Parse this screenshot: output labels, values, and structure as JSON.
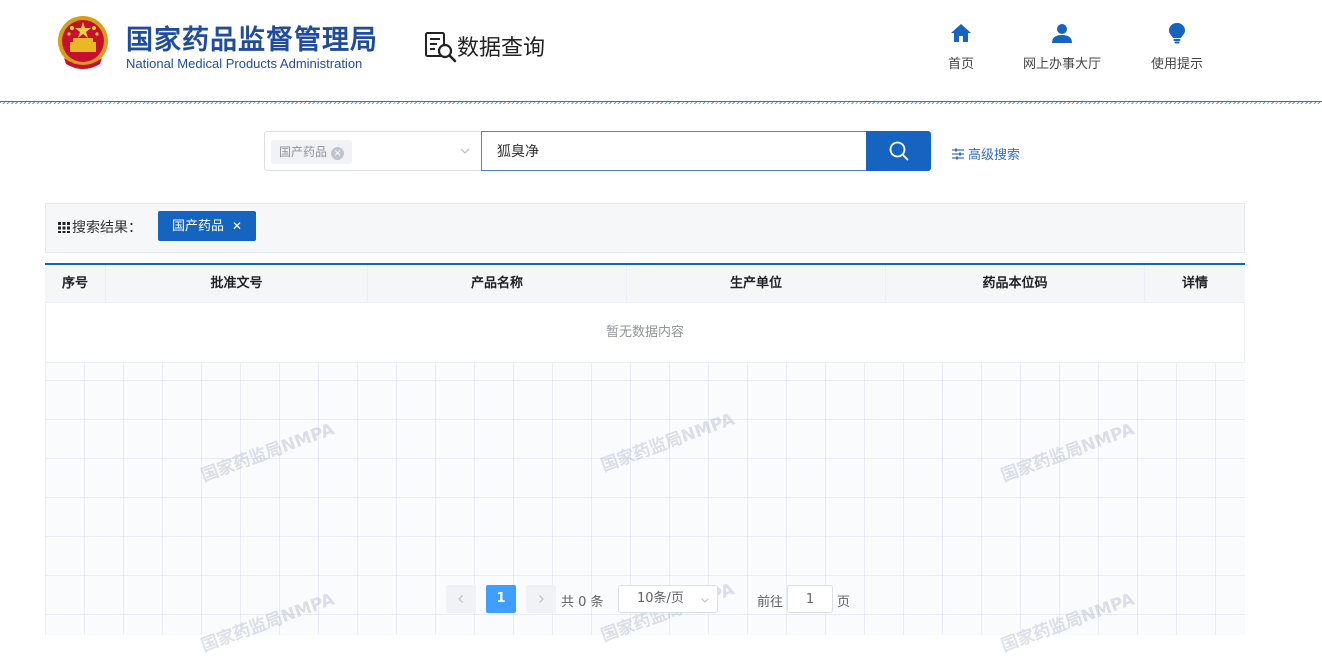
{
  "header": {
    "brand_cn": "国家药品监督管理局",
    "brand_en": "National Medical Products Administration",
    "section_title": "数据查询",
    "nav": [
      {
        "label": "首页",
        "icon": "home-icon"
      },
      {
        "label": "网上办事大厅",
        "icon": "user-icon"
      },
      {
        "label": "使用提示",
        "icon": "lightbulb-icon"
      }
    ]
  },
  "search": {
    "category_tag": "国产药品",
    "query": "狐臭净",
    "advanced_label": "高级搜索"
  },
  "results": {
    "label": "搜索结果：",
    "filter_tag": "国产药品"
  },
  "table": {
    "columns": [
      "序号",
      "批准文号",
      "产品名称",
      "生产单位",
      "药品本位码",
      "详情"
    ],
    "empty_text": "暂无数据内容"
  },
  "pagination": {
    "current_page": "1",
    "total": "共 0 条",
    "page_size": "10条/页",
    "goto_label": "前往",
    "goto_value": "1",
    "goto_unit": "页"
  },
  "watermark": "国家药监局NMPA",
  "colors": {
    "brand_blue": "#1f4c9c",
    "primary": "#1565c0",
    "link": "#2f6fc2",
    "page_active": "#409eff"
  }
}
